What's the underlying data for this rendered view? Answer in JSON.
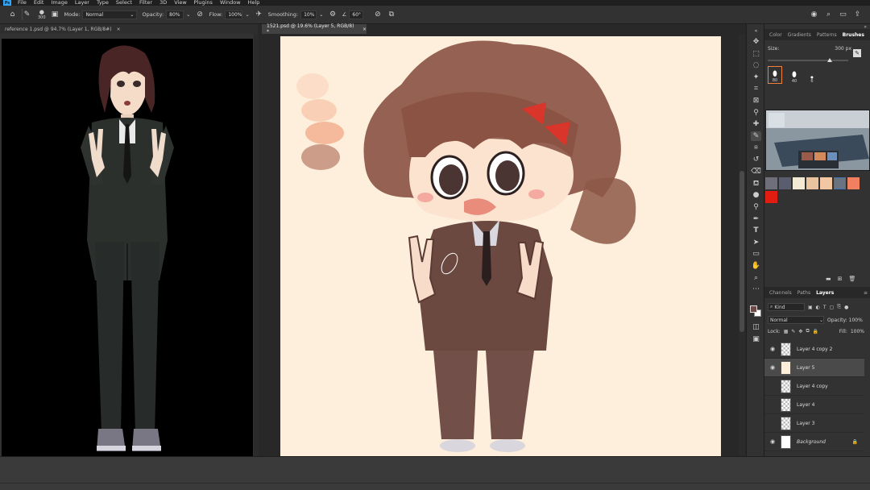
{
  "menu": [
    "File",
    "Edit",
    "Image",
    "Layer",
    "Type",
    "Select",
    "Filter",
    "3D",
    "View",
    "Plugins",
    "Window",
    "Help"
  ],
  "options": {
    "brush_size": "300",
    "mode_label": "Mode:",
    "mode_value": "Normal",
    "opacity_label": "Opacity:",
    "opacity_value": "80%",
    "flow_label": "Flow:",
    "flow_value": "100%",
    "smoothing_label": "Smoothing:",
    "smoothing_value": "10%",
    "angle_value": "60°"
  },
  "tabs": {
    "reference": "reference 1.psd @ 94.7% (Layer 1, RGB/8#)",
    "main": "1521.psd @ 19.6% (Layer 5, RGB/8) *"
  },
  "brush_panel": {
    "tabs": [
      "Color",
      "Gradients",
      "Patterns",
      "Brushes"
    ],
    "size_label": "Size:",
    "size_value": "300 px",
    "presets": [
      "80",
      "40",
      "6"
    ]
  },
  "swatches": [
    "#6f6f7c",
    "#5a5d6e",
    "#f3ead6",
    "#e9c49e",
    "#f3c6a4",
    "#3c73b8",
    "#f0805f",
    "#e01d10"
  ],
  "layers_panel": {
    "tabs": [
      "Channels",
      "Paths",
      "Layers"
    ],
    "filter_value": "Kind",
    "blend_mode": "Normal",
    "opacity_label": "Opacity:",
    "opacity_value": "100%",
    "lock_label": "Lock:",
    "fill_label": "Fill:",
    "fill_value": "100%",
    "layers": [
      {
        "name": "Layer 4 copy 2",
        "visible": true,
        "active": false
      },
      {
        "name": "Layer 5",
        "visible": true,
        "active": true
      },
      {
        "name": "Layer 4 copy",
        "visible": false,
        "active": false
      },
      {
        "name": "Layer 4",
        "visible": false,
        "active": false
      },
      {
        "name": "Layer 3",
        "visible": false,
        "active": false
      },
      {
        "name": "Background",
        "visible": true,
        "active": false,
        "locked": true
      }
    ]
  },
  "colors": {
    "accent": "#31a8ff",
    "canvas_bg": "#fdefdc",
    "foreground": "#6b4a48",
    "background": "#ffffff"
  }
}
